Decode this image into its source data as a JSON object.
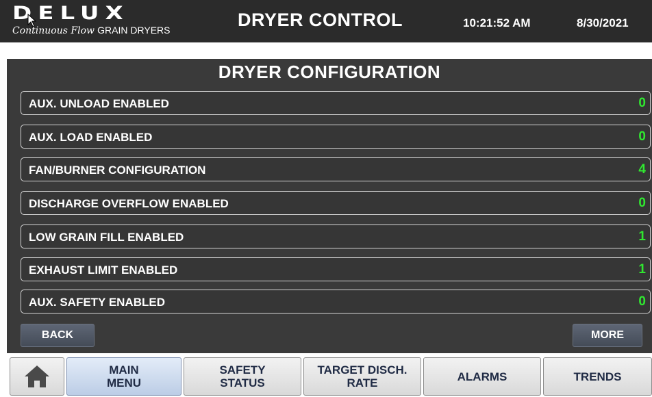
{
  "header": {
    "logo_text": "DELUX",
    "logo_tagline_script": "Continuous Flow",
    "logo_tagline_plain": "GRAIN DRYERS",
    "title": "DRYER CONTROL",
    "time": "10:21:52 AM",
    "date": "8/30/2021"
  },
  "panel": {
    "title": "DRYER CONFIGURATION",
    "rows": [
      {
        "label": "AUX. UNLOAD ENABLED",
        "value": "0"
      },
      {
        "label": "AUX. LOAD ENABLED",
        "value": "0"
      },
      {
        "label": "FAN/BURNER CONFIGURATION",
        "value": "4"
      },
      {
        "label": "DISCHARGE OVERFLOW ENABLED",
        "value": "0"
      },
      {
        "label": "LOW GRAIN FILL ENABLED",
        "value": "1"
      },
      {
        "label": "EXHAUST LIMIT ENABLED",
        "value": "1"
      },
      {
        "label": "AUX. SAFETY ENABLED",
        "value": "0"
      }
    ],
    "back_label": "BACK",
    "more_label": "MORE"
  },
  "nav": {
    "home_icon": "home-icon",
    "items": [
      {
        "label": "MAIN\nMENU"
      },
      {
        "label": "SAFETY\nSTATUS"
      },
      {
        "label": "TARGET DISCH.\nRATE"
      },
      {
        "label": "ALARMS"
      },
      {
        "label": "TRENDS"
      }
    ]
  },
  "colors": {
    "value_green": "#30e830",
    "panel_bg": "#3a3a3a",
    "header_bg": "#2b2b2b"
  }
}
